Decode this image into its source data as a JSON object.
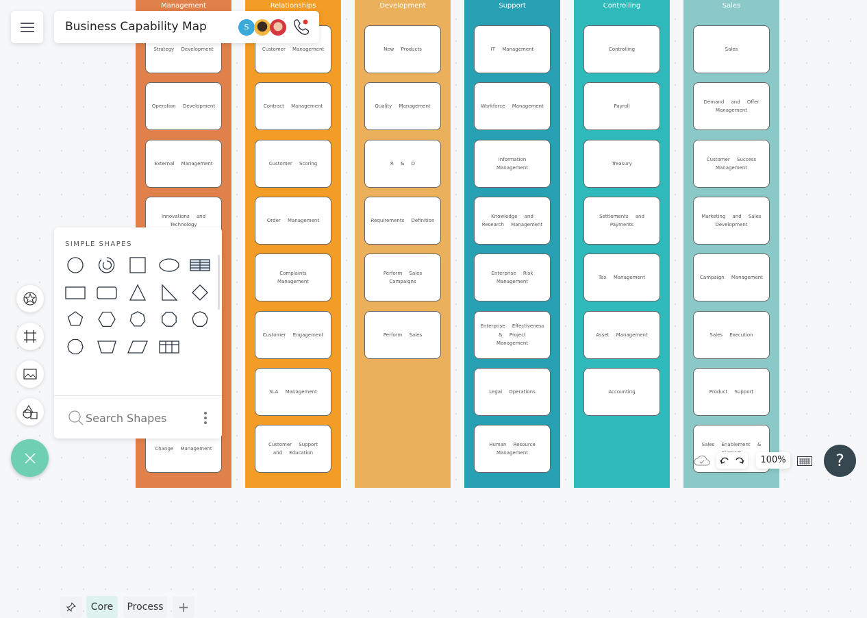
{
  "header": {
    "title": "Business Capability Map",
    "avatar_initial": "S"
  },
  "columns": [
    {
      "title": "Management",
      "color": "#e0804a",
      "cards": [
        "Strategy Development",
        "Operation Development",
        "External Management",
        "Innovations and Technology",
        "",
        "",
        "",
        "Change Management"
      ]
    },
    {
      "title": "Relationships",
      "color": "#f39c26",
      "cards": [
        "Customer Management",
        "Contract Management",
        "Customer Scoring",
        "Order Management",
        "Complaints Management",
        "Customer Engagement",
        "SLA Management",
        "Customer Support and Education"
      ]
    },
    {
      "title": "Development",
      "color": "#ebb05c",
      "cards": [
        "New Products",
        "Quality Management",
        "R & D",
        "Requirements Definition",
        "Perform Sales Campaigns",
        "Perform Sales"
      ]
    },
    {
      "title": "Support",
      "color": "#27a0b4",
      "cards": [
        "IT Management",
        "Workforce Management",
        "Information Management",
        "Knowledge and Research Management",
        "Enterprise Risk Management",
        "Enterprise Effectiveness & Project Management",
        "Legal Operations",
        "Human Resource Management"
      ]
    },
    {
      "title": "Controlling",
      "color": "#2fb9ba",
      "cards": [
        "Controlling",
        "Payroll",
        "Treasury",
        "Settlements and Payments",
        "Tax Management",
        "Asset Management",
        "Accounting"
      ]
    },
    {
      "title": "Sales",
      "color": "#8bc9c9",
      "cards": [
        "Sales",
        "Demand and Offer Management",
        "Customer Success Management",
        "Marketing and Sales Development",
        "Campaign Management",
        "Sales Execution",
        "Product Support",
        "Sales Enablement & Support"
      ]
    }
  ],
  "shapes_panel": {
    "heading": "SIMPLE SHAPES",
    "tabs": [
      "Core",
      "Process"
    ],
    "search_placeholder": "Search Shapes"
  },
  "toolbar": {
    "zoom": "100%",
    "help": "?"
  },
  "colors": {
    "fab": "#6fcfb3",
    "help": "#37474f"
  }
}
